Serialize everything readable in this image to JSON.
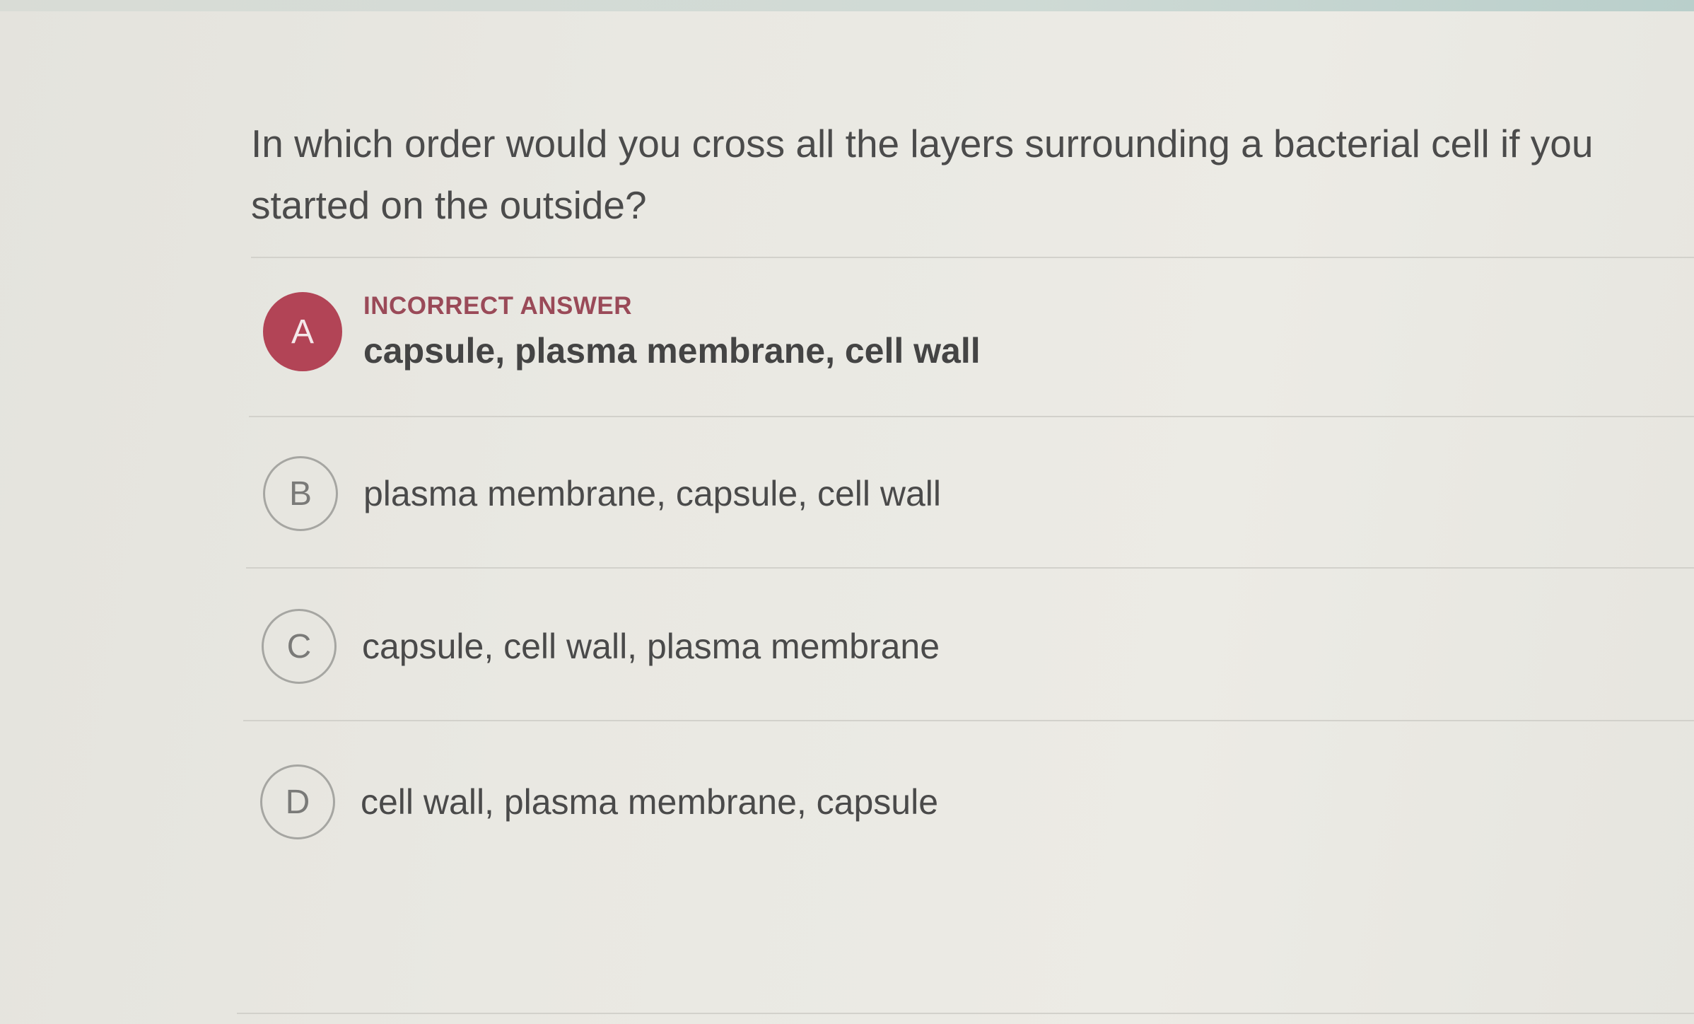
{
  "question": {
    "text": "In which order would you cross all the layers surrounding a bacterial cell if you started on the outside?"
  },
  "options": [
    {
      "letter": "A",
      "status": "INCORRECT ANSWER",
      "text": "capsule, plasma membrane, cell wall",
      "selected": true
    },
    {
      "letter": "B",
      "text": "plasma membrane, capsule, cell wall"
    },
    {
      "letter": "C",
      "text": "capsule, cell wall, plasma membrane"
    },
    {
      "letter": "D",
      "text": "cell wall, plasma membrane, capsule"
    }
  ],
  "colors": {
    "incorrect_accent": "#b24456",
    "status_label": "#9a4a58"
  }
}
